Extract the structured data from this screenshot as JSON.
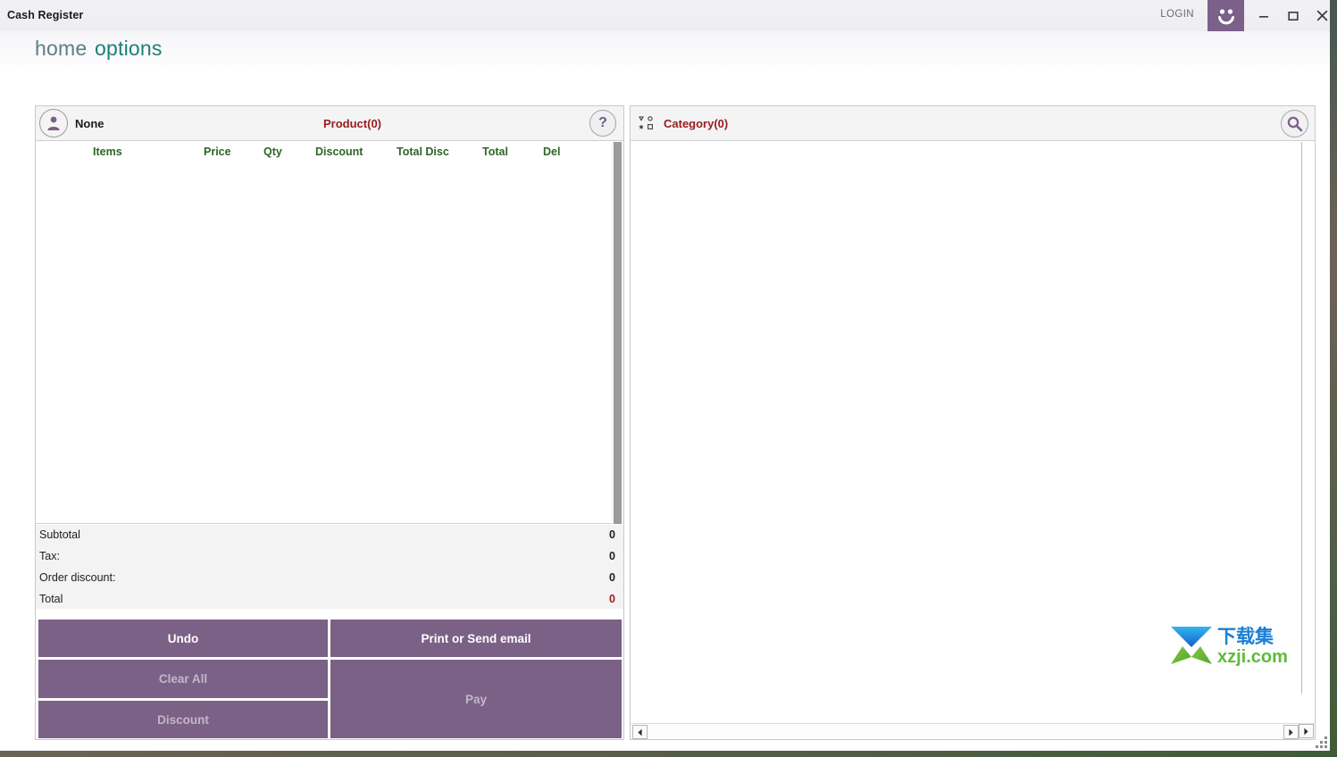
{
  "window": {
    "title": "Cash Register",
    "login_label": "LOGIN",
    "avatar_icon": "smiley-face-icon",
    "minimize_icon": "minimize-icon",
    "maximize_icon": "maximize-icon",
    "close_icon": "close-icon"
  },
  "menubar": {
    "items": [
      {
        "label": "home",
        "color": "#5a8084"
      },
      {
        "label": "options",
        "color": "#1b8079"
      }
    ]
  },
  "cart": {
    "customer_icon": "person-icon",
    "customer_name": "None",
    "product_count": "Product(0)",
    "help_label": "?",
    "columns": [
      "Items",
      "Price",
      "Qty",
      "Discount",
      "Total Disc",
      "Total",
      "Del"
    ],
    "rows": [],
    "totals": [
      {
        "label": "Subtotal",
        "value": "0",
        "emphasis": false
      },
      {
        "label": "Tax:",
        "value": "0",
        "emphasis": false
      },
      {
        "label": "Order discount:",
        "value": "0",
        "emphasis": false
      },
      {
        "label": "Total",
        "value": "0",
        "emphasis": true
      }
    ],
    "buttons": {
      "undo": "Undo",
      "clear_all": "Clear All",
      "discount": "Discount",
      "print_or_send_email": "Print or Send email",
      "pay": "Pay"
    }
  },
  "catalog": {
    "category_icon": "category-grid-icon",
    "category_count": "Category(0)",
    "search_icon": "search-icon",
    "items": [],
    "scroll_left_icon": "arrow-left-icon",
    "scroll_right_icon": "arrow-right-icon",
    "scroll_down_icon": "arrow-down-icon"
  },
  "watermark": {
    "text_cn": "下载集",
    "text_url": "xzji.com"
  },
  "colors": {
    "accent_purple": "#7b6186",
    "header_green": "#2f6428",
    "alert_red": "#9b1b1b",
    "menu_teal": "#1b8079"
  }
}
